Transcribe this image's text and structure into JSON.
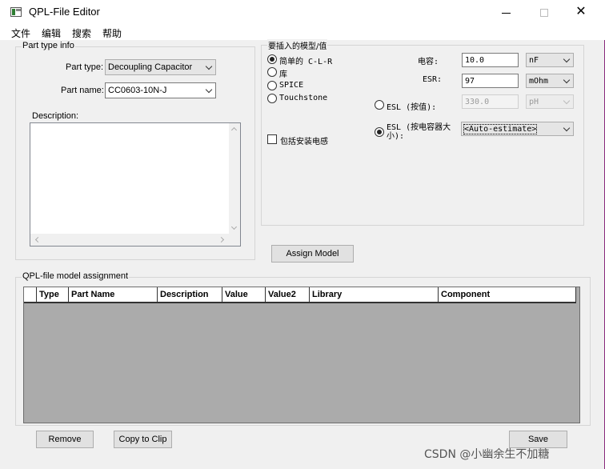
{
  "window": {
    "title": "QPL-File Editor"
  },
  "menu": [
    "文件",
    "编辑",
    "搜索",
    "帮助"
  ],
  "part_type_info": {
    "group_title": "Part type info",
    "part_type_label": "Part type:",
    "part_type_value": "Decoupling Capacitor",
    "part_name_label": "Part name:",
    "part_name_value": "CC0603-10N-J",
    "description_label": "Description:",
    "description_value": ""
  },
  "model_insert": {
    "group_title": "要插入的模型/值",
    "radios": [
      {
        "label": "简单的 C-L-R",
        "checked": true
      },
      {
        "label": "库",
        "checked": false
      },
      {
        "label": "SPICE",
        "checked": false
      },
      {
        "label": "Touchstone",
        "checked": false
      }
    ],
    "capacitance_label": "电容:",
    "capacitance_value": "10.0",
    "capacitance_unit": "nF",
    "esr_label": "ESR:",
    "esr_value": "97",
    "esr_unit": "mOhm",
    "esl_value_radio_label": "ESL (按值):",
    "esl_value": "330.0",
    "esl_unit": "pH",
    "esl_size_radio_label": "ESL (按电容器大小):",
    "esl_size_value": "<Auto-estimate>",
    "include_mounting_label": "包括安装电感"
  },
  "assign_model_button": "Assign Model",
  "assignment": {
    "group_title": "QPL-file model assignment",
    "columns": [
      "Type",
      "Part Name",
      "Description",
      "Value",
      "Value2",
      "Library",
      "Component"
    ]
  },
  "buttons": {
    "remove": "Remove",
    "copy_to_clip": "Copy to Clip",
    "save": "Save"
  },
  "watermark": "CSDN @小幽余生不加糖",
  "colors": {
    "window_bg": "#f0f0f0",
    "desktop": "#b0439c",
    "grid_bg": "#ababab"
  }
}
